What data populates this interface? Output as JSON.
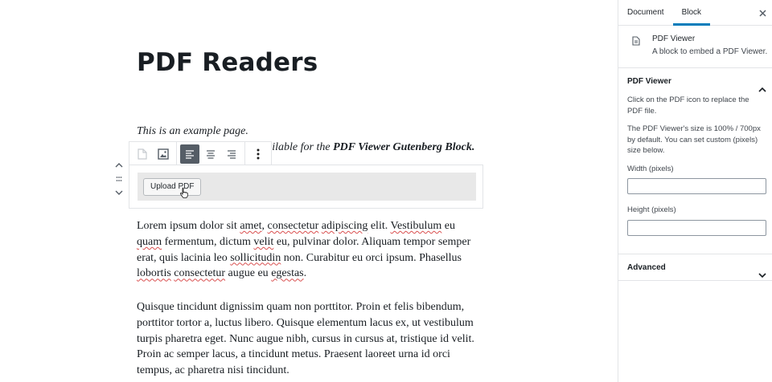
{
  "editor": {
    "title": "PDF Readers",
    "example_line1": "This is an example page.",
    "example_line2_a": "s available for the ",
    "example_line2_b": "PDF Viewer Gutenberg Block.",
    "upload_label": "Upload PDF",
    "p1": [
      {
        "t": "Lorem ipsum dolor sit ",
        "s": false
      },
      {
        "t": "amet",
        "s": true
      },
      {
        "t": ", ",
        "s": false
      },
      {
        "t": "consectetur",
        "s": true
      },
      {
        "t": " ",
        "s": false
      },
      {
        "t": "adipiscing",
        "s": true
      },
      {
        "t": " elit. ",
        "s": false
      },
      {
        "t": "Vestibulum",
        "s": true
      },
      {
        "t": " eu ",
        "s": false
      },
      {
        "t": "quam",
        "s": true
      },
      {
        "t": " fermentum, dictum ",
        "s": false
      },
      {
        "t": "velit",
        "s": true
      },
      {
        "t": " eu, pulvinar dolor. Aliquam tempor semper erat, quis lacinia leo ",
        "s": false
      },
      {
        "t": "sollicitudin",
        "s": true
      },
      {
        "t": " non. Curabitur eu orci ipsum. Phasellus ",
        "s": false
      },
      {
        "t": "lobortis",
        "s": true
      },
      {
        "t": " ",
        "s": false
      },
      {
        "t": "consectetur",
        "s": true
      },
      {
        "t": " augue eu ",
        "s": false
      },
      {
        "t": "egestas",
        "s": true
      },
      {
        "t": ".",
        "s": false
      }
    ],
    "p2": "Quisque tincidunt dignissim quam non porttitor. Proin et felis bibendum, porttitor tortor a, luctus libero. Quisque elementum lacus ex, ut vestibulum turpis pharetra eget. Nunc augue nibh, cursus in cursus at, tristique id velit. Proin ac semper lacus, a tincidunt metus. Praesent laoreet urna id orci tempus, ac pharetra nisi tincidunt."
  },
  "toolbar": {
    "icons": [
      "pdf-file-icon",
      "image-icon",
      "align-left-icon",
      "align-center-icon",
      "align-right-icon",
      "more-options-icon"
    ],
    "active": "align-left-icon"
  },
  "sidebar": {
    "tabs": [
      "Document",
      "Block"
    ],
    "active_tab": "Block",
    "block_name": "PDF Viewer",
    "block_desc": "A block to embed a PDF Viewer.",
    "panel_title": "PDF Viewer",
    "help1": "Click on the PDF icon to replace the PDF file.",
    "help2": "The PDF Viewer's size is 100% / 700px by default. You can set custom (pixels) size below.",
    "width_label": "Width (pixels)",
    "height_label": "Height (pixels)",
    "width_value": "",
    "height_value": "",
    "advanced_title": "Advanced"
  },
  "colors": {
    "accent": "#007cba",
    "spell": "#d94f4f",
    "active_tool": "#555d66"
  }
}
